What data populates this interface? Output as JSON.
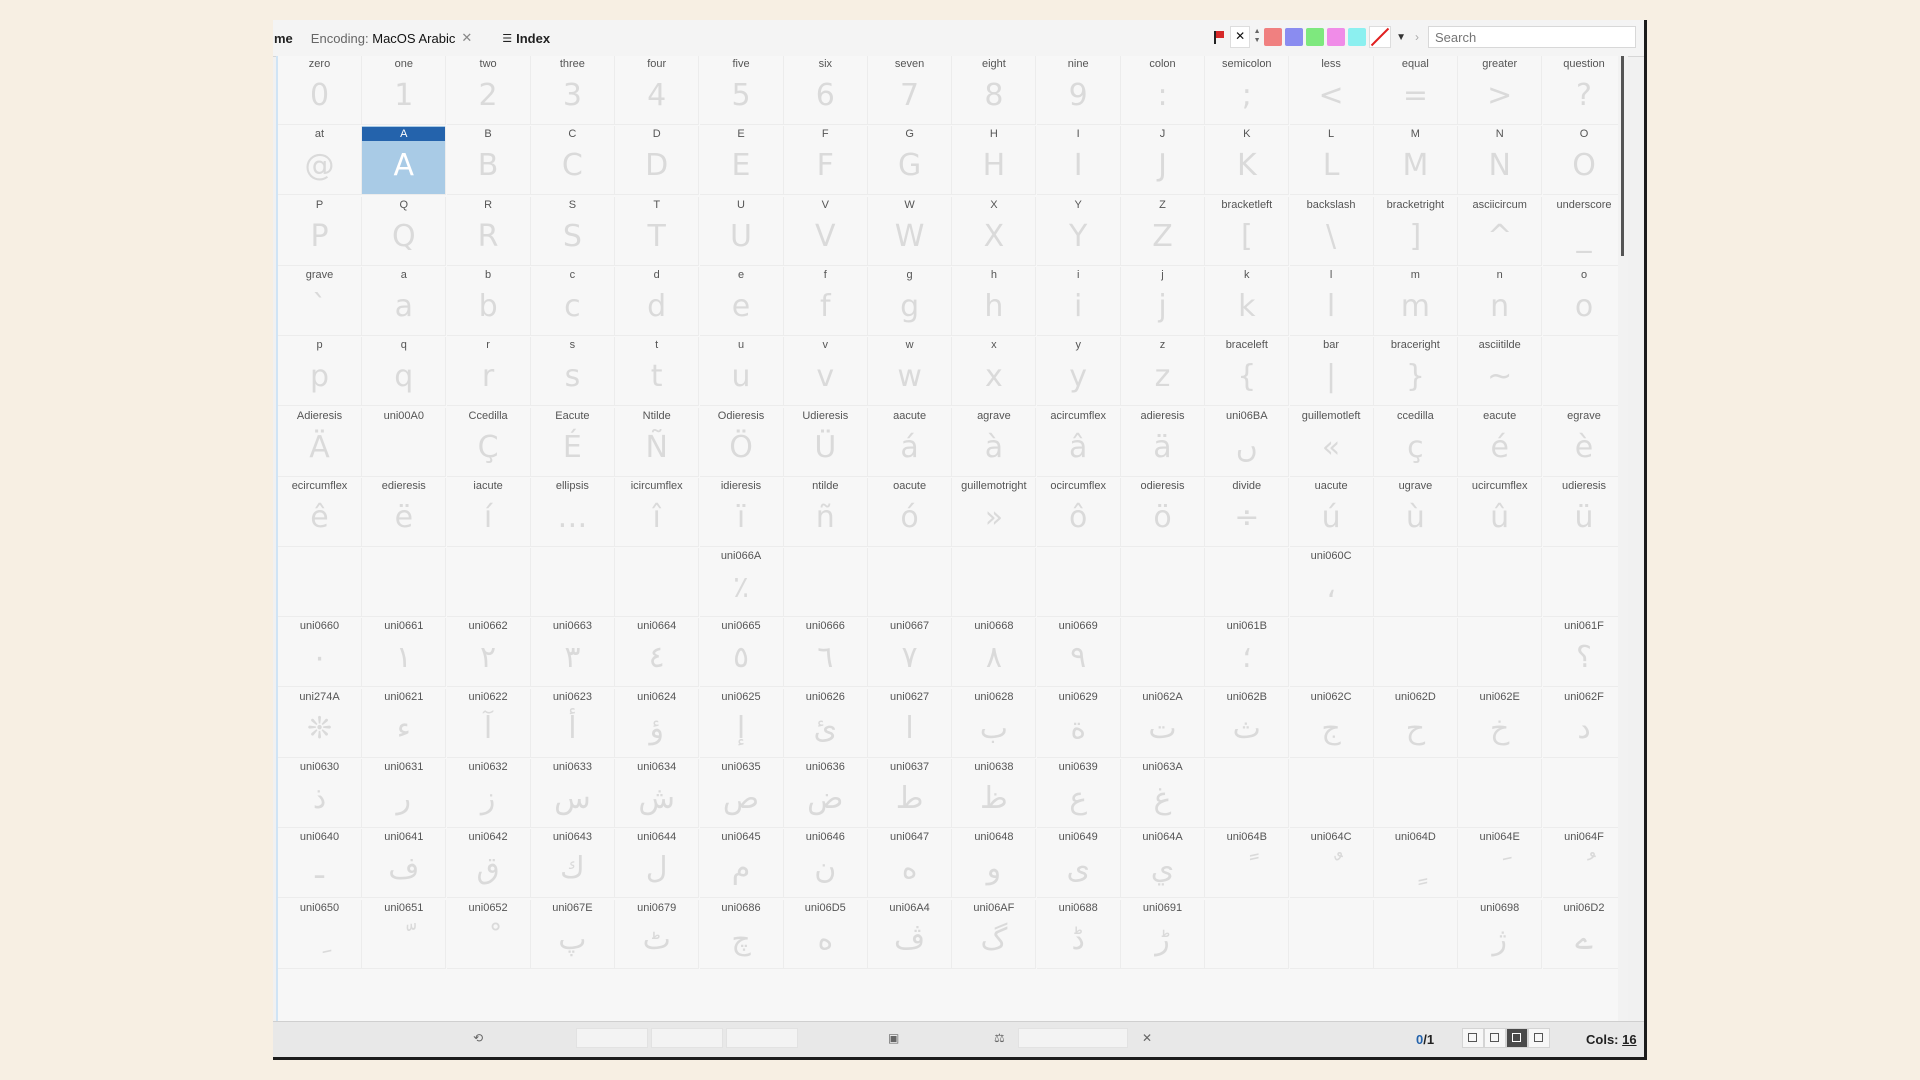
{
  "toolbar": {
    "tab_name": "me",
    "encoding_label": "Encoding:",
    "encoding_value": "MacOS Arabic",
    "index_label": "Index",
    "search_placeholder": "Search",
    "swatches": [
      "#f08080",
      "#8a8cf0",
      "#7ee87e",
      "#f08ce8",
      "#8cf0f0"
    ]
  },
  "status": {
    "count_selected": "0",
    "count_total": "/1",
    "cols_label": "Cols:",
    "cols_value": "16"
  },
  "grid": {
    "selected": "A",
    "rows": [
      [
        [
          "zero",
          "0"
        ],
        [
          "one",
          "1"
        ],
        [
          "two",
          "2"
        ],
        [
          "three",
          "3"
        ],
        [
          "four",
          "4"
        ],
        [
          "five",
          "5"
        ],
        [
          "six",
          "6"
        ],
        [
          "seven",
          "7"
        ],
        [
          "eight",
          "8"
        ],
        [
          "nine",
          "9"
        ],
        [
          "colon",
          ":"
        ],
        [
          "semicolon",
          ";"
        ],
        [
          "less",
          "<"
        ],
        [
          "equal",
          "="
        ],
        [
          "greater",
          ">"
        ],
        [
          "question",
          "?"
        ]
      ],
      [
        [
          "at",
          "@"
        ],
        [
          "A",
          "A"
        ],
        [
          "B",
          "B"
        ],
        [
          "C",
          "C"
        ],
        [
          "D",
          "D"
        ],
        [
          "E",
          "E"
        ],
        [
          "F",
          "F"
        ],
        [
          "G",
          "G"
        ],
        [
          "H",
          "H"
        ],
        [
          "I",
          "I"
        ],
        [
          "J",
          "J"
        ],
        [
          "K",
          "K"
        ],
        [
          "L",
          "L"
        ],
        [
          "M",
          "M"
        ],
        [
          "N",
          "N"
        ],
        [
          "O",
          "O"
        ]
      ],
      [
        [
          "P",
          "P"
        ],
        [
          "Q",
          "Q"
        ],
        [
          "R",
          "R"
        ],
        [
          "S",
          "S"
        ],
        [
          "T",
          "T"
        ],
        [
          "U",
          "U"
        ],
        [
          "V",
          "V"
        ],
        [
          "W",
          "W"
        ],
        [
          "X",
          "X"
        ],
        [
          "Y",
          "Y"
        ],
        [
          "Z",
          "Z"
        ],
        [
          "bracketleft",
          "["
        ],
        [
          "backslash",
          "\\"
        ],
        [
          "bracketright",
          "]"
        ],
        [
          "asciicircum",
          "^"
        ],
        [
          "underscore",
          "_"
        ]
      ],
      [
        [
          "grave",
          "`"
        ],
        [
          "a",
          "a"
        ],
        [
          "b",
          "b"
        ],
        [
          "c",
          "c"
        ],
        [
          "d",
          "d"
        ],
        [
          "e",
          "e"
        ],
        [
          "f",
          "f"
        ],
        [
          "g",
          "g"
        ],
        [
          "h",
          "h"
        ],
        [
          "i",
          "i"
        ],
        [
          "j",
          "j"
        ],
        [
          "k",
          "k"
        ],
        [
          "l",
          "l"
        ],
        [
          "m",
          "m"
        ],
        [
          "n",
          "n"
        ],
        [
          "o",
          "o"
        ]
      ],
      [
        [
          "p",
          "p"
        ],
        [
          "q",
          "q"
        ],
        [
          "r",
          "r"
        ],
        [
          "s",
          "s"
        ],
        [
          "t",
          "t"
        ],
        [
          "u",
          "u"
        ],
        [
          "v",
          "v"
        ],
        [
          "w",
          "w"
        ],
        [
          "x",
          "x"
        ],
        [
          "y",
          "y"
        ],
        [
          "z",
          "z"
        ],
        [
          "braceleft",
          "{"
        ],
        [
          "bar",
          "|"
        ],
        [
          "braceright",
          "}"
        ],
        [
          "asciitilde",
          "~"
        ],
        [
          "",
          ""
        ]
      ],
      [
        [
          "Adieresis",
          "Ä"
        ],
        [
          "uni00A0",
          ""
        ],
        [
          "Ccedilla",
          "Ç"
        ],
        [
          "Eacute",
          "É"
        ],
        [
          "Ntilde",
          "Ñ"
        ],
        [
          "Odieresis",
          "Ö"
        ],
        [
          "Udieresis",
          "Ü"
        ],
        [
          "aacute",
          "á"
        ],
        [
          "agrave",
          "à"
        ],
        [
          "acircumflex",
          "â"
        ],
        [
          "adieresis",
          "ä"
        ],
        [
          "uni06BA",
          "ں"
        ],
        [
          "guillemotleft",
          "«"
        ],
        [
          "ccedilla",
          "ç"
        ],
        [
          "eacute",
          "é"
        ],
        [
          "egrave",
          "è"
        ]
      ],
      [
        [
          "ecircumflex",
          "ê"
        ],
        [
          "edieresis",
          "ë"
        ],
        [
          "iacute",
          "í"
        ],
        [
          "ellipsis",
          "…"
        ],
        [
          "icircumflex",
          "î"
        ],
        [
          "idieresis",
          "ï"
        ],
        [
          "ntilde",
          "ñ"
        ],
        [
          "oacute",
          "ó"
        ],
        [
          "guillemotright",
          "»"
        ],
        [
          "ocircumflex",
          "ô"
        ],
        [
          "odieresis",
          "ö"
        ],
        [
          "divide",
          "÷"
        ],
        [
          "uacute",
          "ú"
        ],
        [
          "ugrave",
          "ù"
        ],
        [
          "ucircumflex",
          "û"
        ],
        [
          "udieresis",
          "ü"
        ]
      ],
      [
        [
          "",
          ""
        ],
        [
          "",
          ""
        ],
        [
          "",
          ""
        ],
        [
          "",
          ""
        ],
        [
          "",
          ""
        ],
        [
          "uni066A",
          "٪"
        ],
        [
          "",
          ""
        ],
        [
          "",
          ""
        ],
        [
          "",
          ""
        ],
        [
          "",
          ""
        ],
        [
          "",
          ""
        ],
        [
          "",
          ""
        ],
        [
          "uni060C",
          "،"
        ],
        [
          "",
          ""
        ],
        [
          "",
          ""
        ],
        [
          "",
          ""
        ]
      ],
      [
        [
          "uni0660",
          "٠"
        ],
        [
          "uni0661",
          "١"
        ],
        [
          "uni0662",
          "٢"
        ],
        [
          "uni0663",
          "٣"
        ],
        [
          "uni0664",
          "٤"
        ],
        [
          "uni0665",
          "٥"
        ],
        [
          "uni0666",
          "٦"
        ],
        [
          "uni0667",
          "٧"
        ],
        [
          "uni0668",
          "٨"
        ],
        [
          "uni0669",
          "٩"
        ],
        [
          "",
          ""
        ],
        [
          "uni061B",
          "؛"
        ],
        [
          "",
          ""
        ],
        [
          "",
          ""
        ],
        [
          "",
          ""
        ],
        [
          "uni061F",
          "؟"
        ]
      ],
      [
        [
          "uni274A",
          "❊"
        ],
        [
          "uni0621",
          "ء"
        ],
        [
          "uni0622",
          "آ"
        ],
        [
          "uni0623",
          "أ"
        ],
        [
          "uni0624",
          "ؤ"
        ],
        [
          "uni0625",
          "إ"
        ],
        [
          "uni0626",
          "ئ"
        ],
        [
          "uni0627",
          "ا"
        ],
        [
          "uni0628",
          "ب"
        ],
        [
          "uni0629",
          "ة"
        ],
        [
          "uni062A",
          "ت"
        ],
        [
          "uni062B",
          "ث"
        ],
        [
          "uni062C",
          "ج"
        ],
        [
          "uni062D",
          "ح"
        ],
        [
          "uni062E",
          "خ"
        ],
        [
          "uni062F",
          "د"
        ]
      ],
      [
        [
          "uni0630",
          "ذ"
        ],
        [
          "uni0631",
          "ر"
        ],
        [
          "uni0632",
          "ز"
        ],
        [
          "uni0633",
          "س"
        ],
        [
          "uni0634",
          "ش"
        ],
        [
          "uni0635",
          "ص"
        ],
        [
          "uni0636",
          "ض"
        ],
        [
          "uni0637",
          "ط"
        ],
        [
          "uni0638",
          "ظ"
        ],
        [
          "uni0639",
          "ع"
        ],
        [
          "uni063A",
          "غ"
        ],
        [
          "",
          ""
        ],
        [
          "",
          ""
        ],
        [
          "",
          ""
        ],
        [
          "",
          ""
        ],
        [
          "",
          ""
        ]
      ],
      [
        [
          "uni0640",
          "ـ"
        ],
        [
          "uni0641",
          "ف"
        ],
        [
          "uni0642",
          "ق"
        ],
        [
          "uni0643",
          "ك"
        ],
        [
          "uni0644",
          "ل"
        ],
        [
          "uni0645",
          "م"
        ],
        [
          "uni0646",
          "ن"
        ],
        [
          "uni0647",
          "ه"
        ],
        [
          "uni0648",
          "و"
        ],
        [
          "uni0649",
          "ى"
        ],
        [
          "uni064A",
          "ي"
        ],
        [
          "uni064B",
          "ً"
        ],
        [
          "uni064C",
          "ٌ"
        ],
        [
          "uni064D",
          "ٍ"
        ],
        [
          "uni064E",
          "َ"
        ],
        [
          "uni064F",
          "ُ"
        ]
      ],
      [
        [
          "uni0650",
          "ِ"
        ],
        [
          "uni0651",
          "ّ"
        ],
        [
          "uni0652",
          "ْ"
        ],
        [
          "uni067E",
          "پ"
        ],
        [
          "uni0679",
          "ٹ"
        ],
        [
          "uni0686",
          "چ"
        ],
        [
          "uni06D5",
          "ە"
        ],
        [
          "uni06A4",
          "ڤ"
        ],
        [
          "uni06AF",
          "گ"
        ],
        [
          "uni0688",
          "ڈ"
        ],
        [
          "uni0691",
          "ڑ"
        ],
        [
          "",
          ""
        ],
        [
          "",
          ""
        ],
        [
          "",
          ""
        ],
        [
          "uni0698",
          "ژ"
        ],
        [
          "uni06D2",
          "ے"
        ]
      ]
    ]
  }
}
